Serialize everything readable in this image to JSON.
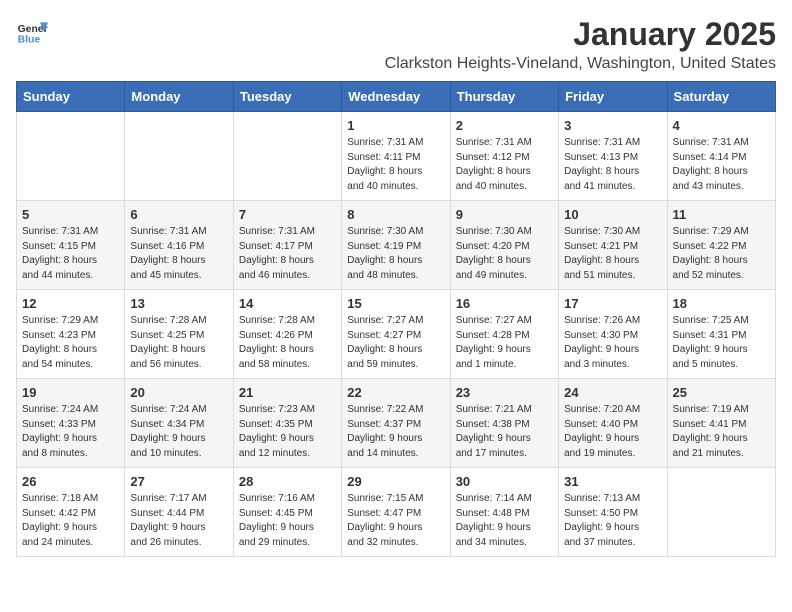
{
  "header": {
    "logo_line1": "General",
    "logo_line2": "Blue",
    "title": "January 2025",
    "subtitle": "Clarkston Heights-Vineland, Washington, United States"
  },
  "weekdays": [
    "Sunday",
    "Monday",
    "Tuesday",
    "Wednesday",
    "Thursday",
    "Friday",
    "Saturday"
  ],
  "weeks": [
    [
      {
        "day": "",
        "info": ""
      },
      {
        "day": "",
        "info": ""
      },
      {
        "day": "",
        "info": ""
      },
      {
        "day": "1",
        "info": "Sunrise: 7:31 AM\nSunset: 4:11 PM\nDaylight: 8 hours\nand 40 minutes."
      },
      {
        "day": "2",
        "info": "Sunrise: 7:31 AM\nSunset: 4:12 PM\nDaylight: 8 hours\nand 40 minutes."
      },
      {
        "day": "3",
        "info": "Sunrise: 7:31 AM\nSunset: 4:13 PM\nDaylight: 8 hours\nand 41 minutes."
      },
      {
        "day": "4",
        "info": "Sunrise: 7:31 AM\nSunset: 4:14 PM\nDaylight: 8 hours\nand 43 minutes."
      }
    ],
    [
      {
        "day": "5",
        "info": "Sunrise: 7:31 AM\nSunset: 4:15 PM\nDaylight: 8 hours\nand 44 minutes."
      },
      {
        "day": "6",
        "info": "Sunrise: 7:31 AM\nSunset: 4:16 PM\nDaylight: 8 hours\nand 45 minutes."
      },
      {
        "day": "7",
        "info": "Sunrise: 7:31 AM\nSunset: 4:17 PM\nDaylight: 8 hours\nand 46 minutes."
      },
      {
        "day": "8",
        "info": "Sunrise: 7:30 AM\nSunset: 4:19 PM\nDaylight: 8 hours\nand 48 minutes."
      },
      {
        "day": "9",
        "info": "Sunrise: 7:30 AM\nSunset: 4:20 PM\nDaylight: 8 hours\nand 49 minutes."
      },
      {
        "day": "10",
        "info": "Sunrise: 7:30 AM\nSunset: 4:21 PM\nDaylight: 8 hours\nand 51 minutes."
      },
      {
        "day": "11",
        "info": "Sunrise: 7:29 AM\nSunset: 4:22 PM\nDaylight: 8 hours\nand 52 minutes."
      }
    ],
    [
      {
        "day": "12",
        "info": "Sunrise: 7:29 AM\nSunset: 4:23 PM\nDaylight: 8 hours\nand 54 minutes."
      },
      {
        "day": "13",
        "info": "Sunrise: 7:28 AM\nSunset: 4:25 PM\nDaylight: 8 hours\nand 56 minutes."
      },
      {
        "day": "14",
        "info": "Sunrise: 7:28 AM\nSunset: 4:26 PM\nDaylight: 8 hours\nand 58 minutes."
      },
      {
        "day": "15",
        "info": "Sunrise: 7:27 AM\nSunset: 4:27 PM\nDaylight: 8 hours\nand 59 minutes."
      },
      {
        "day": "16",
        "info": "Sunrise: 7:27 AM\nSunset: 4:28 PM\nDaylight: 9 hours\nand 1 minute."
      },
      {
        "day": "17",
        "info": "Sunrise: 7:26 AM\nSunset: 4:30 PM\nDaylight: 9 hours\nand 3 minutes."
      },
      {
        "day": "18",
        "info": "Sunrise: 7:25 AM\nSunset: 4:31 PM\nDaylight: 9 hours\nand 5 minutes."
      }
    ],
    [
      {
        "day": "19",
        "info": "Sunrise: 7:24 AM\nSunset: 4:33 PM\nDaylight: 9 hours\nand 8 minutes."
      },
      {
        "day": "20",
        "info": "Sunrise: 7:24 AM\nSunset: 4:34 PM\nDaylight: 9 hours\nand 10 minutes."
      },
      {
        "day": "21",
        "info": "Sunrise: 7:23 AM\nSunset: 4:35 PM\nDaylight: 9 hours\nand 12 minutes."
      },
      {
        "day": "22",
        "info": "Sunrise: 7:22 AM\nSunset: 4:37 PM\nDaylight: 9 hours\nand 14 minutes."
      },
      {
        "day": "23",
        "info": "Sunrise: 7:21 AM\nSunset: 4:38 PM\nDaylight: 9 hours\nand 17 minutes."
      },
      {
        "day": "24",
        "info": "Sunrise: 7:20 AM\nSunset: 4:40 PM\nDaylight: 9 hours\nand 19 minutes."
      },
      {
        "day": "25",
        "info": "Sunrise: 7:19 AM\nSunset: 4:41 PM\nDaylight: 9 hours\nand 21 minutes."
      }
    ],
    [
      {
        "day": "26",
        "info": "Sunrise: 7:18 AM\nSunset: 4:42 PM\nDaylight: 9 hours\nand 24 minutes."
      },
      {
        "day": "27",
        "info": "Sunrise: 7:17 AM\nSunset: 4:44 PM\nDaylight: 9 hours\nand 26 minutes."
      },
      {
        "day": "28",
        "info": "Sunrise: 7:16 AM\nSunset: 4:45 PM\nDaylight: 9 hours\nand 29 minutes."
      },
      {
        "day": "29",
        "info": "Sunrise: 7:15 AM\nSunset: 4:47 PM\nDaylight: 9 hours\nand 32 minutes."
      },
      {
        "day": "30",
        "info": "Sunrise: 7:14 AM\nSunset: 4:48 PM\nDaylight: 9 hours\nand 34 minutes."
      },
      {
        "day": "31",
        "info": "Sunrise: 7:13 AM\nSunset: 4:50 PM\nDaylight: 9 hours\nand 37 minutes."
      },
      {
        "day": "",
        "info": ""
      }
    ]
  ]
}
